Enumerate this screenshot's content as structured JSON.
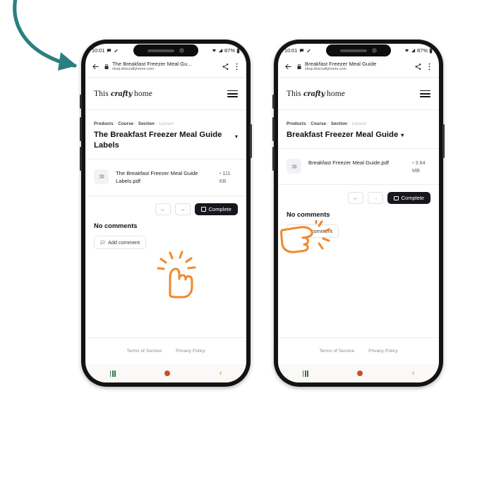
{
  "canvas": {
    "background": "#ffffff"
  },
  "annotation": {
    "arrow_icon": "curved-arrow-down-right-icon",
    "color": "#2a7f82"
  },
  "theme": {
    "accent_dark": "#17181d",
    "cursor_orange": "#f08a2e",
    "nav_recents_green": "#2f7a45",
    "nav_home_red": "#d04a2c",
    "nav_back_orange": "#e08a32",
    "muted_text": "#8d8d8d"
  },
  "phones": [
    {
      "id": "phone-left",
      "status_bar": {
        "time": "10:01",
        "left_icons": [
          "chat-bubble-icon",
          "edit-pencil-icon"
        ],
        "right_icons": [
          "wifi-icon",
          "cellular-signal-icon",
          "battery-icon"
        ],
        "battery": "87%"
      },
      "browser": {
        "back_icon": "arrow-left-icon",
        "lock_icon": "lock-icon",
        "page_title": "The Breakfast Freezer Meal Gu...",
        "host": "shop.thiscraftyhome.com",
        "share_icon": "share-icon",
        "menu_icon": "more-vertical-icon"
      },
      "site_header": {
        "logo_prefix": "This",
        "logo_script": "crafty",
        "logo_suffix": "home",
        "menu_icon": "hamburger-menu-icon"
      },
      "lesson": {
        "breadcrumb": [
          "Products",
          "Course",
          "Section",
          "Lesson"
        ],
        "title": "The Breakfast Freezer Meal Guide Labels",
        "dropdown_icon": "caret-down-icon",
        "dropdown_inline": false
      },
      "attachment": {
        "file_icon": "document-lines-icon",
        "name": "The Breakfast Freezer Meal Guide Labels.pdf",
        "size_dot": "•",
        "size": "111 KB"
      },
      "nav": {
        "prev_icon": "arrow-left-icon",
        "next_icon": "arrow-right-icon",
        "prev_enabled": true,
        "next_enabled": true,
        "complete_label": "Complete",
        "complete_checkbox_icon": "checkbox-empty-icon"
      },
      "comments": {
        "heading": "No comments",
        "add_label": "Add comment",
        "add_icon": "comment-bubble-icon"
      },
      "footer": {
        "links": [
          "Terms of Service",
          "Privacy Policy"
        ]
      },
      "android_nav": {
        "recents_icon": "recents-icon",
        "home_icon": "home-circle-icon",
        "back_icon": "back-chevron-icon"
      },
      "cursor": {
        "icon": "tapping-hand-up-icon"
      }
    },
    {
      "id": "phone-right",
      "status_bar": {
        "time": "10:01",
        "left_icons": [
          "chat-bubble-icon",
          "edit-pencil-icon"
        ],
        "right_icons": [
          "wifi-icon",
          "cellular-signal-icon",
          "battery-icon"
        ],
        "battery": "87%"
      },
      "browser": {
        "back_icon": "arrow-left-icon",
        "lock_icon": "lock-icon",
        "page_title": "Breakfast Freezer Meal Guide",
        "host": "shop.thiscraftyhome.com",
        "share_icon": "share-icon",
        "menu_icon": "more-vertical-icon"
      },
      "site_header": {
        "logo_prefix": "This",
        "logo_script": "crafty",
        "logo_suffix": "home",
        "menu_icon": "hamburger-menu-icon"
      },
      "lesson": {
        "breadcrumb": [
          "Products",
          "Course",
          "Section",
          "Lesson"
        ],
        "title": "Breakfast Freezer Meal Guide",
        "dropdown_icon": "caret-down-icon",
        "dropdown_inline": true
      },
      "attachment": {
        "file_icon": "document-lines-icon",
        "name": "Breakfast Freezer Meal Guide.pdf",
        "size_dot": "•",
        "size": "3.64 MB"
      },
      "nav": {
        "prev_icon": "arrow-left-icon",
        "next_icon": "arrow-right-icon",
        "prev_enabled": true,
        "next_enabled": false,
        "complete_label": "Complete",
        "complete_checkbox_icon": "checkbox-empty-icon"
      },
      "comments": {
        "heading": "No comments",
        "add_label": "Add comment",
        "add_icon": "comment-bubble-icon"
      },
      "footer": {
        "links": [
          "Terms of Service",
          "Privacy Policy"
        ]
      },
      "android_nav": {
        "recents_icon": "recents-icon",
        "home_icon": "home-circle-icon",
        "back_icon": "back-chevron-icon"
      },
      "cursor": {
        "icon": "tapping-hand-left-icon"
      }
    }
  ]
}
